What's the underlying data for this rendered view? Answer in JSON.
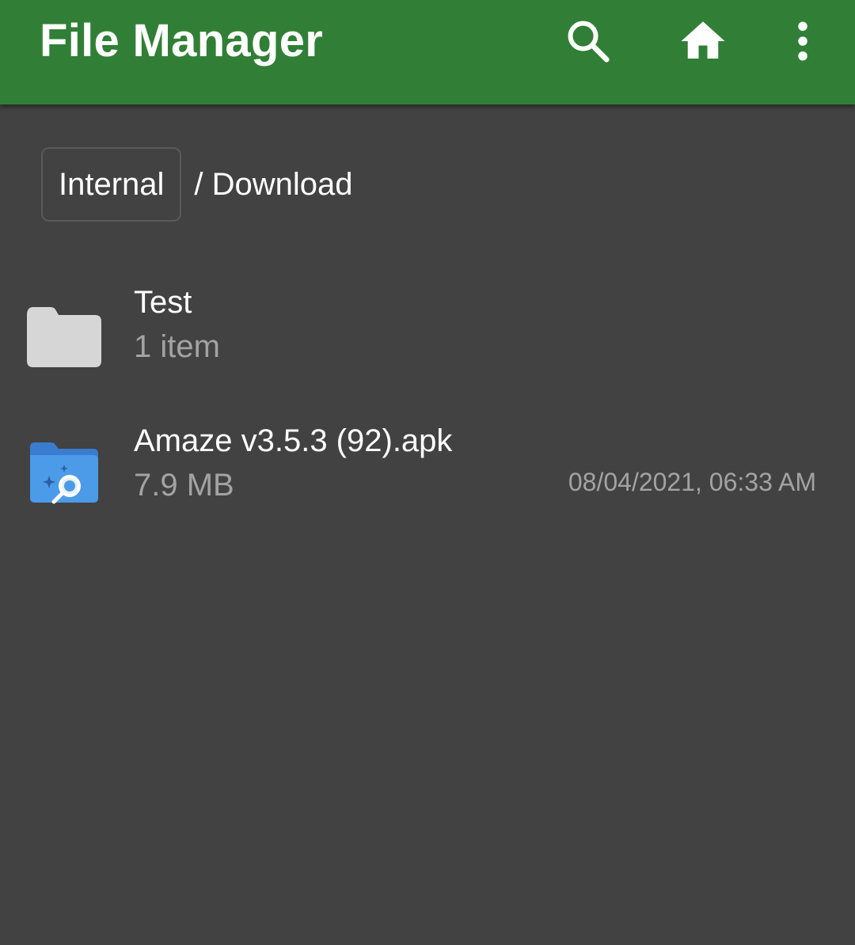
{
  "app": {
    "title": "File Manager",
    "colors": {
      "toolbar": "#317f36",
      "background": "#424242",
      "primary_text": "#ffffff",
      "secondary_text": "#a3a3a3"
    }
  },
  "toolbar": {
    "actions": [
      {
        "icon": "search-icon"
      },
      {
        "icon": "home-icon"
      },
      {
        "icon": "more-vert-icon"
      }
    ]
  },
  "breadcrumb": {
    "root": "Internal",
    "path": "/ Download"
  },
  "files": [
    {
      "icon": "folder-icon",
      "name": "Test",
      "meta": "1 item",
      "date": ""
    },
    {
      "icon": "apk-file-icon",
      "name": "Amaze v3.5.3 (92).apk",
      "meta": "7.9 MB",
      "date": "08/04/2021, 06:33 AM"
    }
  ]
}
